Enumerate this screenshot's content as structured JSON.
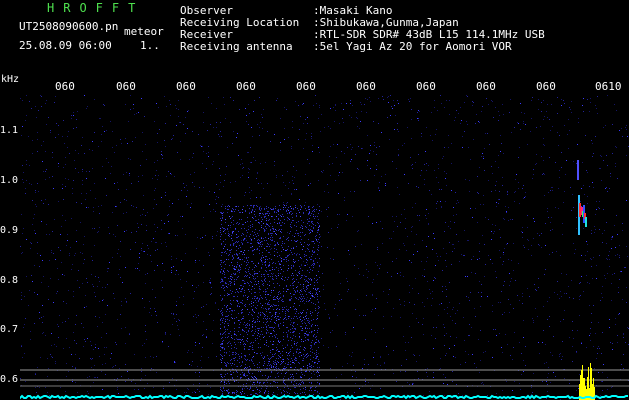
{
  "header": {
    "app_title": "HROFFT",
    "filename": "UT2508090600.pn",
    "category": "meteor",
    "datetime": "25.08.09 06:00",
    "count": "1.."
  },
  "info": [
    {
      "label": "Observer",
      "value": ":Masaki Kano"
    },
    {
      "label": "Receiving Location",
      "value": ":Shibukawa,Gunma,Japan"
    },
    {
      "label": "Receiver",
      "value": ":RTL-SDR SDR# 43dB L15 114.1MHz USB"
    },
    {
      "label": "Receiving antenna",
      "value": ":5el Yagi Az 20 for Aomori VOR"
    }
  ],
  "time_axis": {
    "labels": [
      "060",
      "060",
      "060",
      "060",
      "060",
      "060",
      "060",
      "060",
      "060",
      "0610"
    ]
  },
  "freq_axis": {
    "unit": "kHz",
    "labels": [
      "1.1",
      "1.0",
      "0.9",
      "0.8",
      "0.7",
      "0.6"
    ]
  },
  "colors": {
    "background": "#000000",
    "title": "#4ee04e",
    "noise": "#1a1a8c",
    "signal": "#ffff00",
    "baseline": "#00ffff"
  }
}
